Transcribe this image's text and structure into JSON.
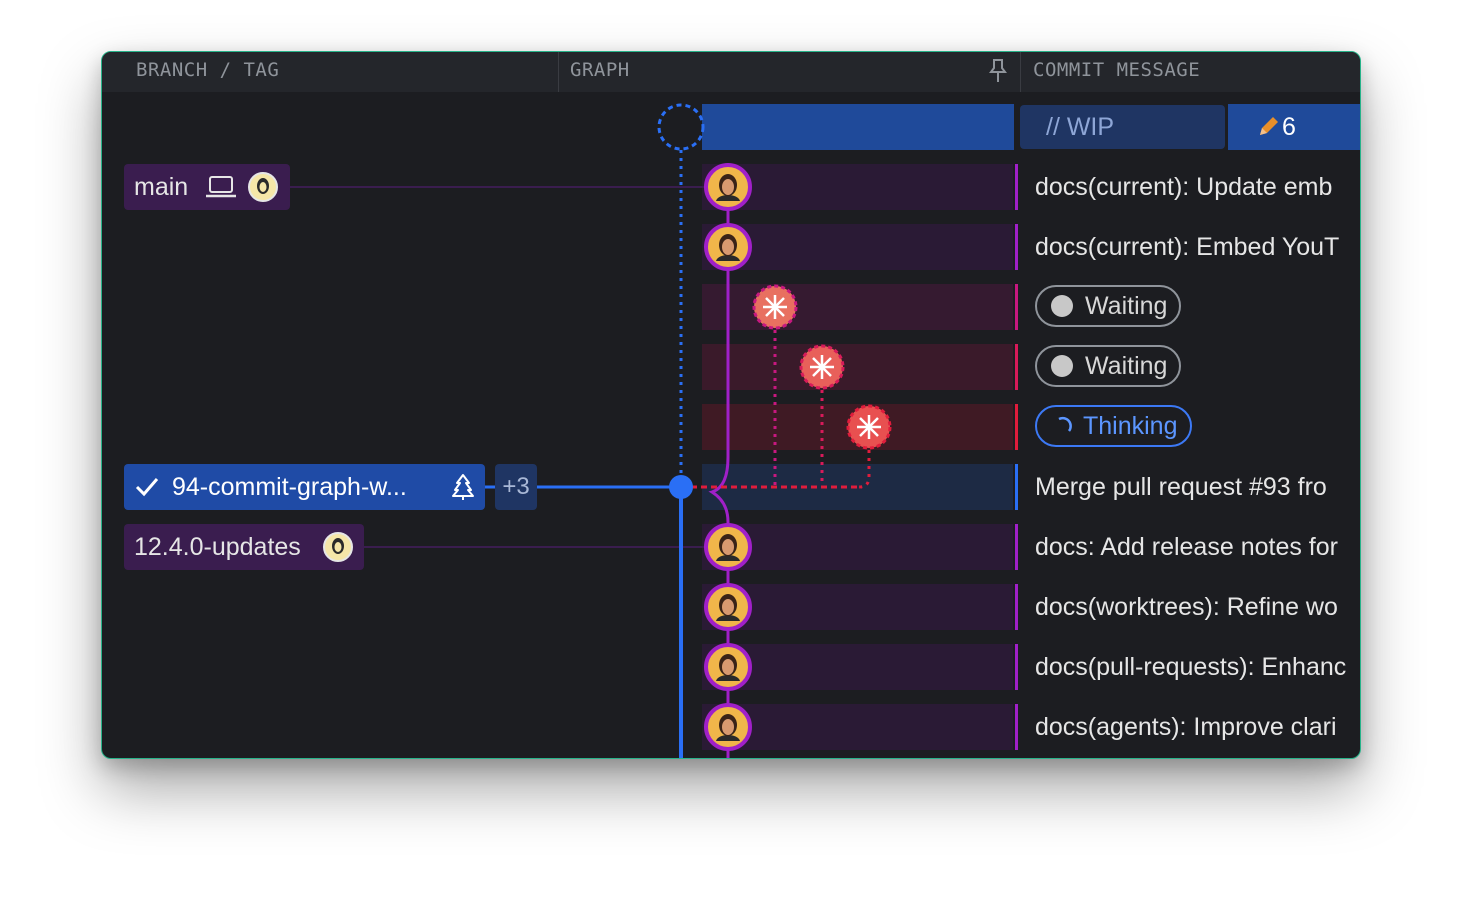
{
  "header": {
    "branch_tag": "BRANCH / TAG",
    "graph": "GRAPH",
    "commit_message": "COMMIT MESSAGE"
  },
  "wip": {
    "label": "// WIP",
    "count": "6"
  },
  "branches": {
    "main": "main",
    "current": "94-commit-graph-w...",
    "more": "+3",
    "updates": "12.4.0-updates"
  },
  "commits": [
    {
      "message": "docs(current): Update emb"
    },
    {
      "message": "docs(current): Embed YouT"
    },
    {
      "status": "Waiting"
    },
    {
      "status": "Waiting"
    },
    {
      "status": "Thinking"
    },
    {
      "message": "Merge pull request #93 fro"
    },
    {
      "message": "docs: Add release notes for"
    },
    {
      "message": "docs(worktrees): Refine wo"
    },
    {
      "message": "docs(pull-requests): Enhanc"
    },
    {
      "message": "docs(agents): Improve clari"
    }
  ],
  "colors": {
    "purple_lane": "#a020c8",
    "blue_lane": "#2a6ff5",
    "magenta_agent": "#d01880",
    "red_agent": "#e01c3c",
    "accent_border": "#27b38a"
  },
  "icons": [
    "pin-icon",
    "pencil-icon",
    "laptop-icon",
    "avatar-icon",
    "check-icon",
    "tree-icon",
    "spinner-icon",
    "spark-icon"
  ]
}
